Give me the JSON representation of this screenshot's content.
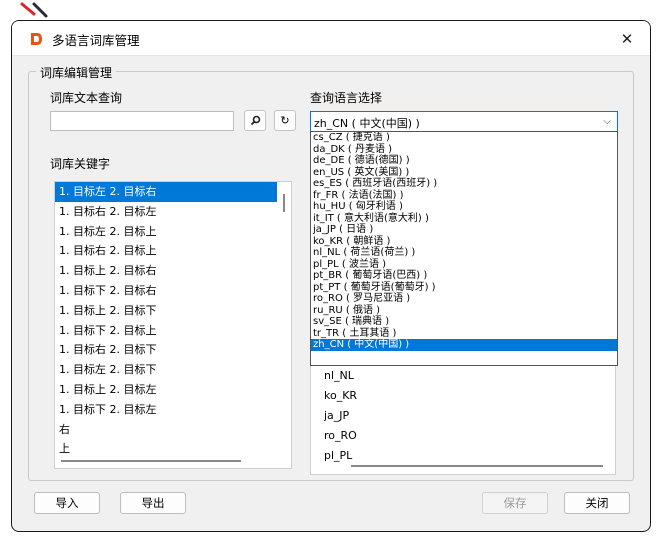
{
  "window": {
    "title": "多语言词库管理",
    "close_symbol": "✕"
  },
  "group": {
    "title": "词库编辑管理"
  },
  "search": {
    "label": "词库文本查询",
    "value": "",
    "search_icon": "search-icon",
    "refresh_symbol": "↻"
  },
  "keywords": {
    "label": "词库关键字",
    "items": [
      "1. 目标左 2. 目标右",
      "1. 目标右 2. 目标左",
      "1. 目标左 2. 目标上",
      "1. 目标右 2. 目标上",
      "1. 目标上 2. 目标右",
      "1. 目标下 2. 目标右",
      "1. 目标上 2. 目标下",
      "1. 目标下 2. 目标上",
      "1. 目标右 2. 目标下",
      "1. 目标左 2. 目标下",
      "1. 目标上 2. 目标左",
      "1. 目标下 2. 目标左",
      "右",
      "上"
    ],
    "selected_index": 0
  },
  "language": {
    "label": "查询语言选择",
    "selected": "zh_CN ( 中文(中国) )",
    "options": [
      "cs_CZ ( 捷克语 )",
      "da_DK ( 丹麦语 )",
      "de_DE ( 德语(德国) )",
      "en_US ( 英文(美国) )",
      "es_ES ( 西班牙语(西班牙) )",
      "fr_FR ( 法语(法国) )",
      "hu_HU ( 匈牙利语 )",
      "it_IT ( 意大利语(意大利) )",
      "ja_JP ( 日语 )",
      "ko_KR ( 朝鲜语 )",
      "nl_NL ( 荷兰语(荷兰) )",
      "pl_PL ( 波兰语 )",
      "pt_BR ( 葡萄牙语(巴西) )",
      "pt_PT ( 葡萄牙语(葡萄牙) )",
      "ro_RO ( 罗马尼亚语 )",
      "ru_RU ( 俄语 )",
      "sv_SE ( 瑞典语 )",
      "tr_TR ( 土耳其语 )",
      "zh_CN ( 中文(中国) )"
    ],
    "selected_index": 18,
    "visible_rows": [
      "nl_NL",
      "ko_KR",
      "ja_JP",
      "ro_RO",
      "pl_PL"
    ]
  },
  "buttons": {
    "import": "导入",
    "export": "导出",
    "save": "保存",
    "close": "关闭"
  },
  "colors": {
    "accent": "#0078d7",
    "app_icon": "#e8531d"
  }
}
